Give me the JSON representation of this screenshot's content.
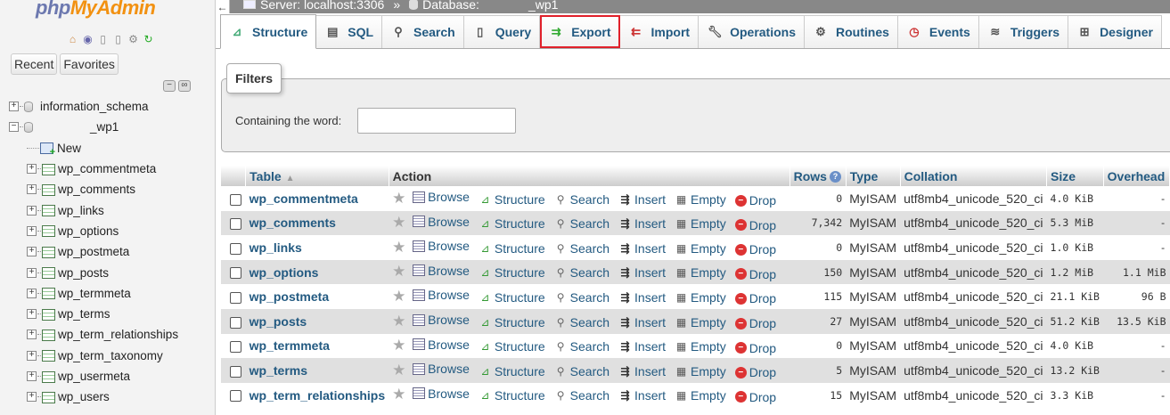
{
  "logo": {
    "php": "php",
    "myadmin": "MyAdmin"
  },
  "sidebar": {
    "recent_label": "Recent",
    "favorites_label": "Favorites",
    "tree": {
      "db1": "information_schema",
      "db2": "_wp1",
      "new_label": "New",
      "tables": [
        "wp_commentmeta",
        "wp_comments",
        "wp_links",
        "wp_options",
        "wp_postmeta",
        "wp_posts",
        "wp_termmeta",
        "wp_terms",
        "wp_term_relationships",
        "wp_term_taxonomy",
        "wp_usermeta",
        "wp_users"
      ]
    }
  },
  "breadcrumb": {
    "server": "Server: localhost:3306",
    "separator": "»",
    "database": "Database:",
    "database_name": "_wp1"
  },
  "tabs": [
    {
      "label": "Structure",
      "icon": "structure-icon",
      "active": true
    },
    {
      "label": "SQL",
      "icon": "sql-icon"
    },
    {
      "label": "Search",
      "icon": "search-icon"
    },
    {
      "label": "Query",
      "icon": "query-icon"
    },
    {
      "label": "Export",
      "icon": "export-icon",
      "highlight": "#e0202a"
    },
    {
      "label": "Import",
      "icon": "import-icon"
    },
    {
      "label": "Operations",
      "icon": "wrench-icon"
    },
    {
      "label": "Routines",
      "icon": "routines-icon"
    },
    {
      "label": "Events",
      "icon": "clock-icon"
    },
    {
      "label": "Triggers",
      "icon": "triggers-icon"
    },
    {
      "label": "Designer",
      "icon": "designer-icon"
    }
  ],
  "filters": {
    "legend": "Filters",
    "label": "Containing the word:",
    "value": ""
  },
  "table": {
    "headers": {
      "table": "Table",
      "action": "Action",
      "rows": "Rows",
      "type": "Type",
      "collation": "Collation",
      "size": "Size",
      "overhead": "Overhead"
    },
    "action_labels": {
      "browse": "Browse",
      "structure": "Structure",
      "search": "Search",
      "insert": "Insert",
      "empty": "Empty",
      "drop": "Drop"
    },
    "rows": [
      {
        "name": "wp_commentmeta",
        "rows": "0",
        "type": "MyISAM",
        "collation": "utf8mb4_unicode_520_ci",
        "size": "4.0",
        "size_unit": "KiB",
        "overhead": "-",
        "overhead_unit": ""
      },
      {
        "name": "wp_comments",
        "rows": "7,342",
        "type": "MyISAM",
        "collation": "utf8mb4_unicode_520_ci",
        "size": "5.3",
        "size_unit": "MiB",
        "overhead": "-",
        "overhead_unit": ""
      },
      {
        "name": "wp_links",
        "rows": "0",
        "type": "MyISAM",
        "collation": "utf8mb4_unicode_520_ci",
        "size": "1.0",
        "size_unit": "KiB",
        "overhead": "-",
        "overhead_unit": ""
      },
      {
        "name": "wp_options",
        "rows": "150",
        "type": "MyISAM",
        "collation": "utf8mb4_unicode_520_ci",
        "size": "1.2",
        "size_unit": "MiB",
        "overhead": "1.1",
        "overhead_unit": "MiB"
      },
      {
        "name": "wp_postmeta",
        "rows": "115",
        "type": "MyISAM",
        "collation": "utf8mb4_unicode_520_ci",
        "size": "21.1",
        "size_unit": "KiB",
        "overhead": "96",
        "overhead_unit": "B"
      },
      {
        "name": "wp_posts",
        "rows": "27",
        "type": "MyISAM",
        "collation": "utf8mb4_unicode_520_ci",
        "size": "51.2",
        "size_unit": "KiB",
        "overhead": "13.5",
        "overhead_unit": "KiB"
      },
      {
        "name": "wp_termmeta",
        "rows": "0",
        "type": "MyISAM",
        "collation": "utf8mb4_unicode_520_ci",
        "size": "4.0",
        "size_unit": "KiB",
        "overhead": "-",
        "overhead_unit": ""
      },
      {
        "name": "wp_terms",
        "rows": "5",
        "type": "MyISAM",
        "collation": "utf8mb4_unicode_520_ci",
        "size": "13.2",
        "size_unit": "KiB",
        "overhead": "-",
        "overhead_unit": ""
      },
      {
        "name": "wp_term_relationships",
        "rows": "15",
        "type": "MyISAM",
        "collation": "utf8mb4_unicode_520_ci",
        "size": "3.3",
        "size_unit": "KiB",
        "overhead": "-",
        "overhead_unit": ""
      }
    ]
  }
}
